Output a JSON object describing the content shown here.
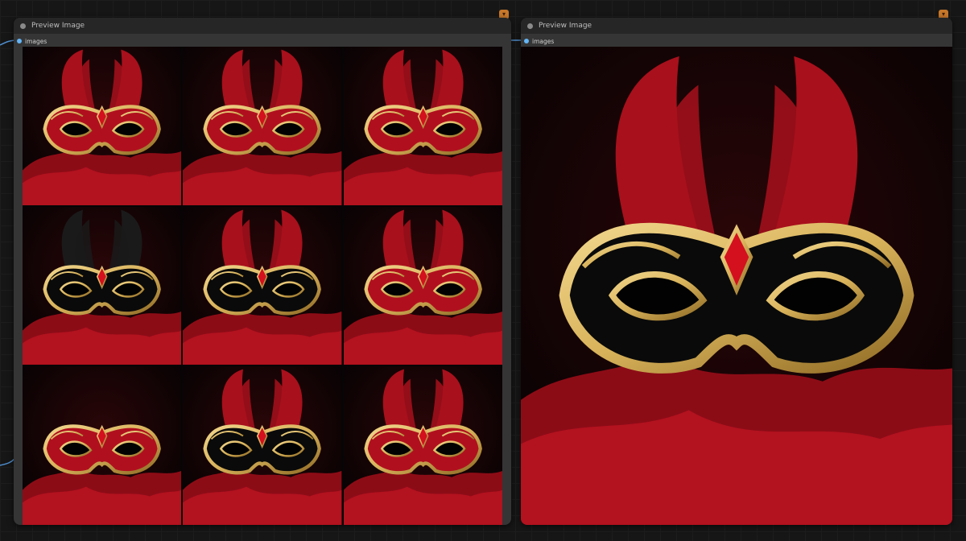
{
  "nodes": [
    {
      "title": "Preview Image",
      "output_label": "images",
      "image_count": 9,
      "layout": "grid-3x3"
    },
    {
      "title": "Preview Image",
      "output_label": "images",
      "image_count": 1,
      "layout": "single"
    }
  ],
  "badge_icon": "fox-icon",
  "colors": {
    "canvas_bg": "#161616",
    "node_bg": "#353535",
    "title_bar": "#262626",
    "slot_blue": "#64b5f6",
    "badge_orange": "#c8782a",
    "mask_red": "#b0101e",
    "mask_gold": "#d8b25a",
    "mask_black": "#0a0a0a"
  },
  "thumbnails": [
    {
      "mask_color": "red",
      "feathers": "red"
    },
    {
      "mask_color": "red",
      "feathers": "red"
    },
    {
      "mask_color": "red",
      "feathers": "red"
    },
    {
      "mask_color": "black",
      "feathers": "black"
    },
    {
      "mask_color": "black",
      "feathers": "red"
    },
    {
      "mask_color": "red",
      "feathers": "red"
    },
    {
      "mask_color": "red",
      "feathers": "none"
    },
    {
      "mask_color": "black",
      "feathers": "red"
    },
    {
      "mask_color": "red",
      "feathers": "red"
    }
  ],
  "large_image": {
    "mask_color": "black",
    "feathers": "red"
  }
}
